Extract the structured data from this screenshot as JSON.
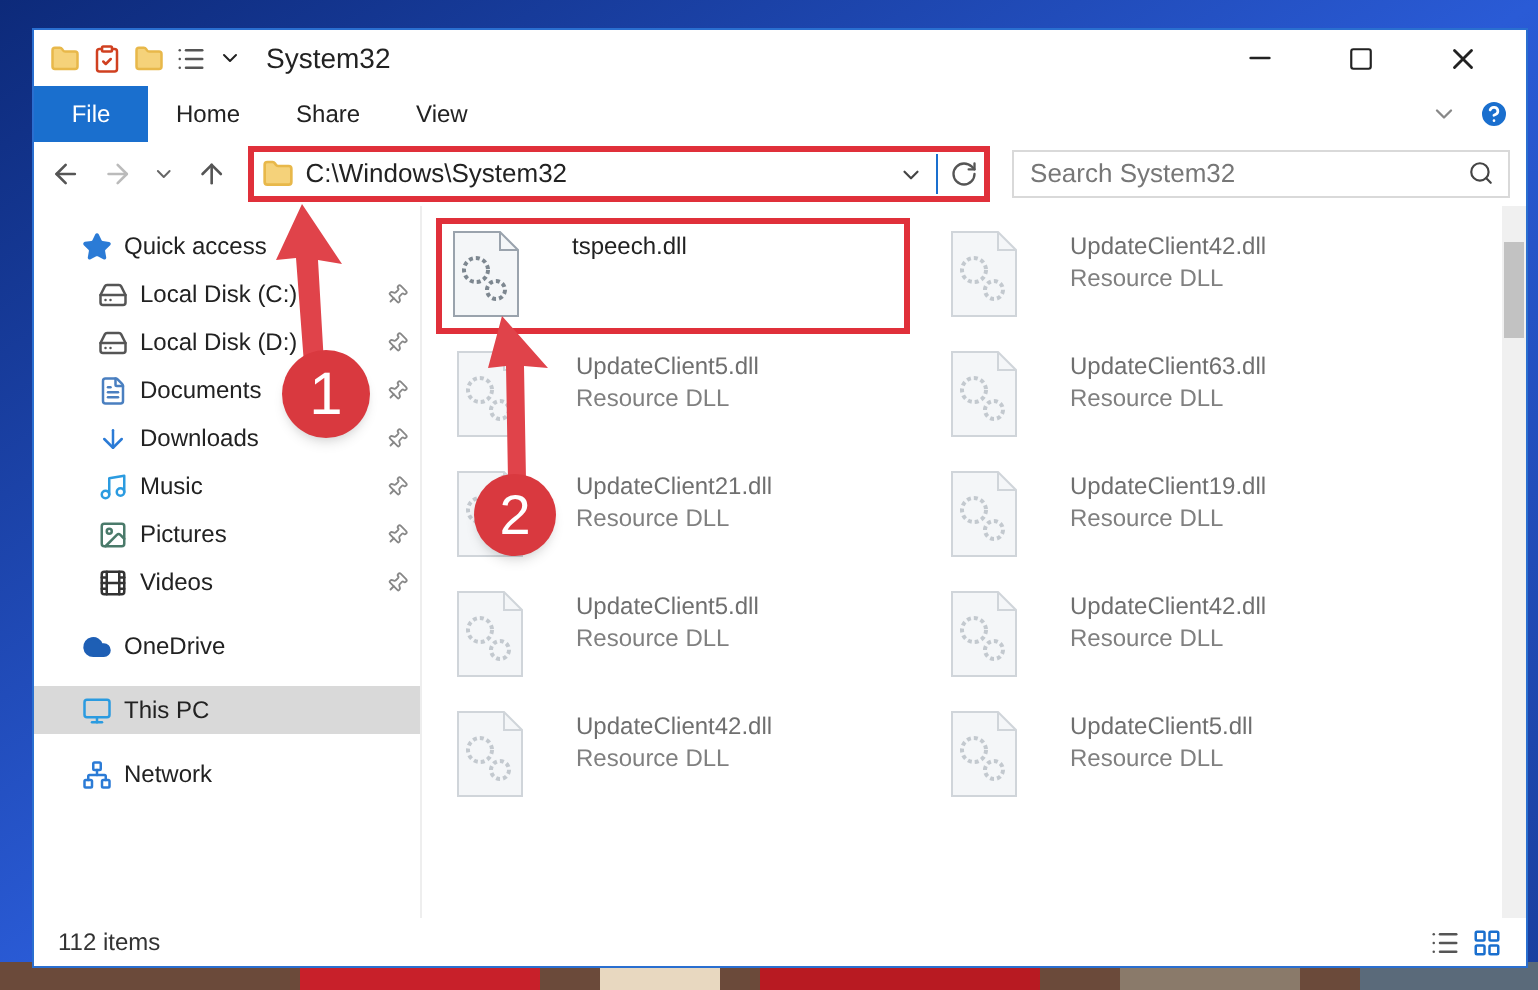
{
  "window": {
    "title": "System32"
  },
  "ribbon_tabs": [
    {
      "label": "File",
      "selected": true
    },
    {
      "label": "Home",
      "selected": false
    },
    {
      "label": "Share",
      "selected": false
    },
    {
      "label": "View",
      "selected": false
    }
  ],
  "address": {
    "path": "C:\\Windows\\System32",
    "highlighted": true
  },
  "search": {
    "placeholder": "Search System32"
  },
  "sidebar": {
    "items": [
      {
        "label": "Quick access",
        "selected": false,
        "children": [
          {
            "label": "Local Disk (C:)",
            "pinned": true,
            "selected": false
          },
          {
            "label": "Local Disk (D:)",
            "pinned": true,
            "selected": false
          },
          {
            "label": "Documents",
            "pinned": true,
            "selected": false
          },
          {
            "label": "Downloads",
            "pinned": true,
            "selected": false
          },
          {
            "label": "Music",
            "pinned": true,
            "selected": false
          },
          {
            "label": "Pictures",
            "pinned": true,
            "selected": false
          },
          {
            "label": "Videos",
            "pinned": true,
            "selected": false
          }
        ]
      },
      {
        "label": "OneDrive",
        "selected": false
      },
      {
        "label": "This PC",
        "selected": true
      },
      {
        "label": "Network",
        "selected": false
      }
    ]
  },
  "files": [
    {
      "name": "tspeech.dll",
      "highlighted": true
    },
    {
      "name": "UpdateClient42.dll",
      "type": "Resource DLL",
      "highlighted": false
    },
    {
      "name": "UpdateClient5.dll",
      "type": "Resource DLL",
      "highlighted": false
    },
    {
      "name": "UpdateClient63.dll",
      "type": "Resource DLL",
      "highlighted": false
    },
    {
      "name": "UpdateClient21.dll",
      "type": "Resource DLL",
      "highlighted": false
    },
    {
      "name": "UpdateClient19.dll",
      "type": "Resource DLL",
      "highlighted": false
    },
    {
      "name": "UpdateClient5.dll",
      "type": "Resource DLL",
      "highlighted": false
    },
    {
      "name": "UpdateClient42.dll",
      "type": "Resource DLL",
      "highlighted": false
    },
    {
      "name": "UpdateClient42.dll",
      "type": "Resource DLL",
      "highlighted": false
    },
    {
      "name": "UpdateClient5.dll",
      "type": "Resource DLL",
      "highlighted": false
    }
  ],
  "status_bar": {
    "count": "112 items"
  },
  "annotations": [
    {
      "number": "1"
    },
    {
      "number": "2"
    }
  ]
}
